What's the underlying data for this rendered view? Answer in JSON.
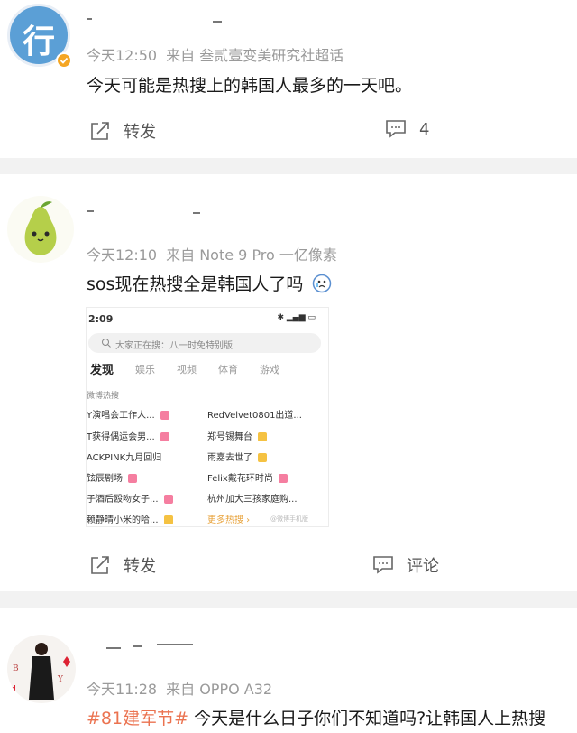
{
  "posts": [
    {
      "avatar_text": "行",
      "time": "今天12:50",
      "source": "来自 叁贰壹变美研究社超话",
      "content": "今天可能是热搜上的韩国人最多的一天吧。",
      "repost_label": "转发",
      "comment_count": "4"
    },
    {
      "time": "今天12:10",
      "source": "来自 Note 9 Pro 一亿像素",
      "content": "sos现在热搜全是韩国人了吗",
      "repost_label": "转发",
      "comment_label": "评论",
      "embedded_screenshot": {
        "status_time": "2:09",
        "search_placeholder": "大家正在搜：八一时免特别版",
        "tabs": [
          "发现",
          "娱乐",
          "视频",
          "体育",
          "游戏"
        ],
        "section_title": "微博热搜",
        "left_items": [
          "Y演唱会工作人...",
          "T获得偶运会男...",
          "ACKPINK九月回归",
          "铉辰剧场",
          "子酒后殴吻女子...",
          "赖静晴小米的哈..."
        ],
        "right_items": [
          "RedVelvet0801出道...",
          "郑号锡舞台",
          "雨嘉去世了",
          "Felix戴花环时尚",
          "杭州加大三孩家庭购..."
        ],
        "more_label": "更多热搜",
        "watermark": "@微博手机版"
      }
    },
    {
      "time": "今天11:28",
      "source": "来自 OPPO A32",
      "hashtag": "#81建军节#",
      "content": " 今天是什么日子你们不知道吗?让韩国人上热搜"
    }
  ],
  "colors": {
    "separator": "#f2f2f2",
    "meta": "#9a9a9a",
    "hashtag": "#eb7350",
    "verified_badge": "#f5a623"
  }
}
